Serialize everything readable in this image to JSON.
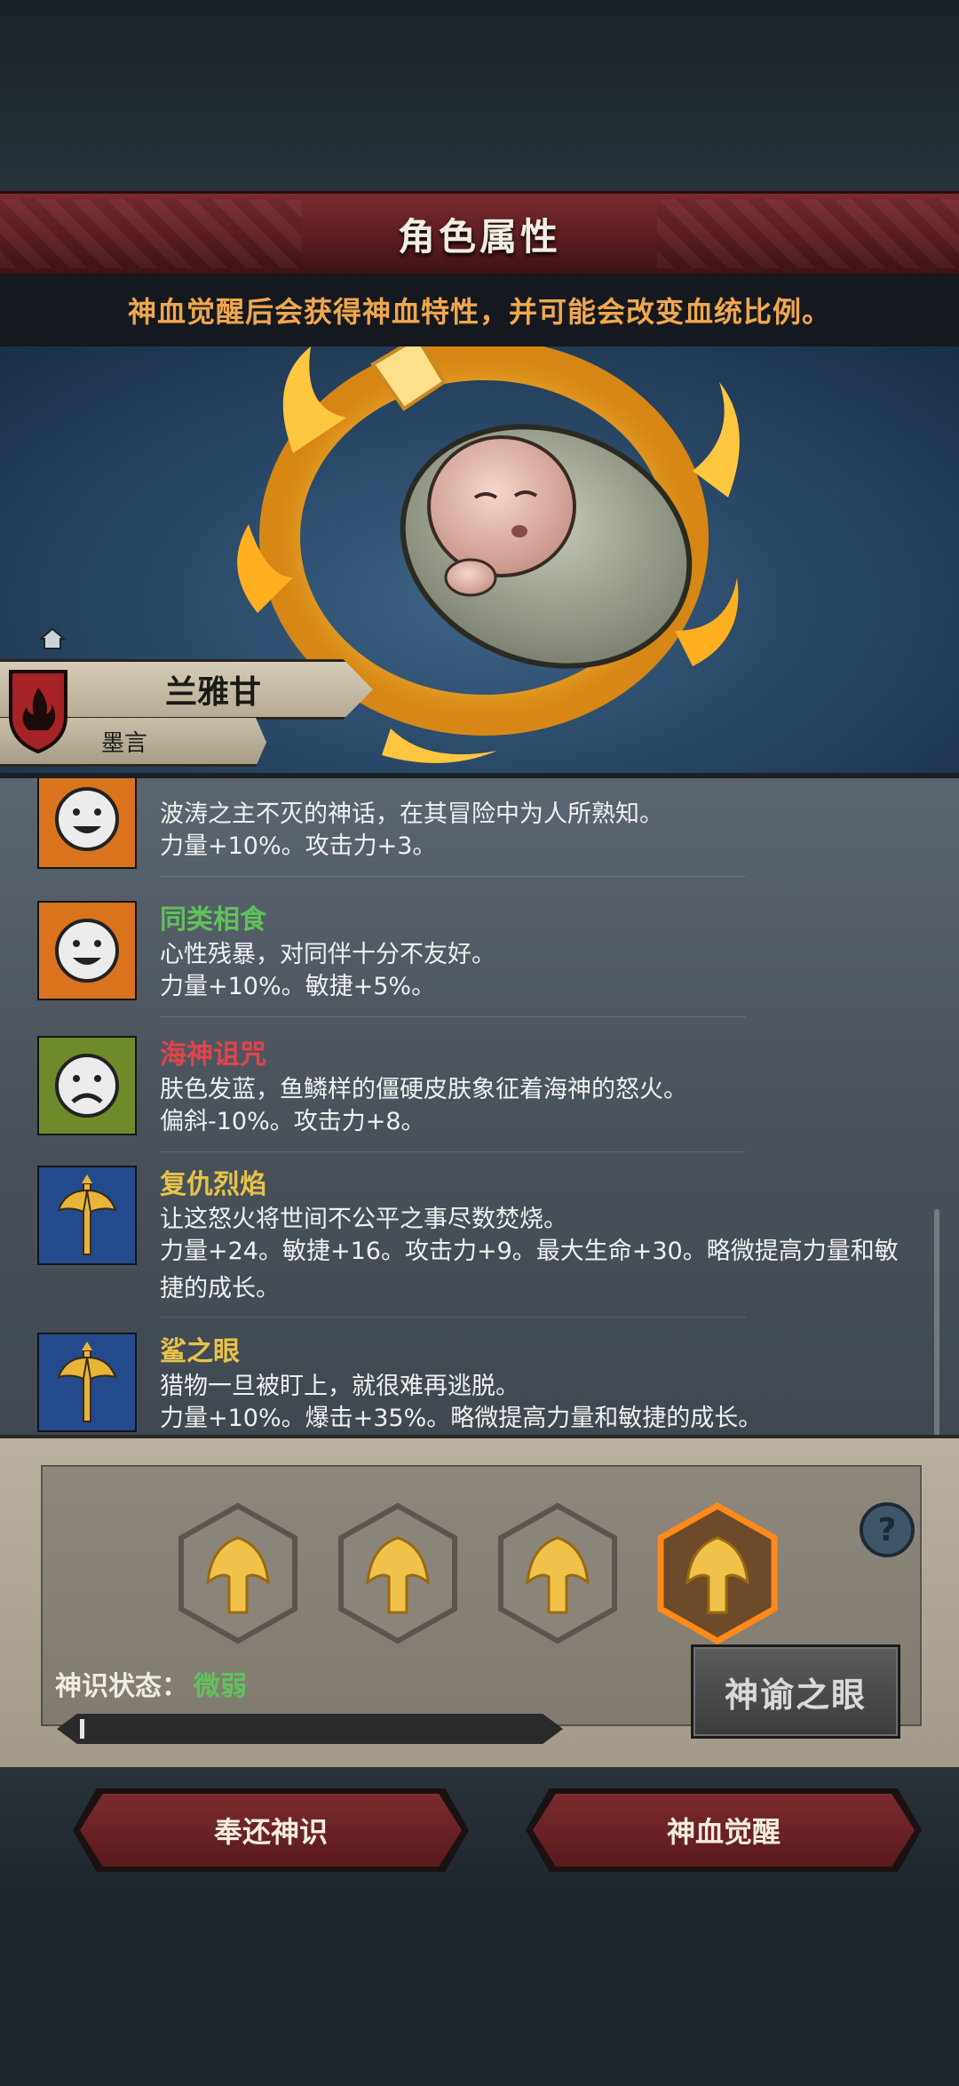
{
  "header": {
    "title": "角色属性",
    "subtitle": "神血觉醒后会获得神血特性，并可能会改变血统比例。"
  },
  "character": {
    "name": "兰雅甘",
    "subname": "墨言",
    "emblem_icon": "fire-shield-icon"
  },
  "traits": [
    {
      "icon": "smile-face-icon",
      "name": "",
      "name_color": "#5fc25a",
      "desc": "波涛之主不灭的神话，在其冒险中为人所熟知。",
      "effect": "力量+10%。攻击力+3。"
    },
    {
      "icon": "smile-face-icon",
      "name": "同类相食",
      "name_color": "#5fc25a",
      "desc": "心性残暴，对同伴十分不友好。",
      "effect": "力量+10%。敏捷+5%。"
    },
    {
      "icon": "sad-face-icon",
      "name": "海神诅咒",
      "name_color": "#e0444a",
      "desc": "肤色发蓝，鱼鳞样的僵硬皮肤象征着海神的怒火。",
      "effect": "偏斜-10%。攻击力+8。"
    },
    {
      "icon": "axe-icon",
      "name": "复仇烈焰",
      "name_color": "#e6c34a",
      "desc": "让这怒火将世间不公平之事尽数焚烧。",
      "effect": "力量+24。敏捷+16。攻击力+9。最大生命+30。略微提高力量和敏捷的成长。"
    },
    {
      "icon": "axe-icon",
      "name": "鲨之眼",
      "name_color": "#e6c34a",
      "desc": "猎物一旦被盯上，就很难再逃脱。",
      "effect": "力量+10%。爆击+35%。略微提高力量和敏捷的成长。"
    }
  ],
  "divine": {
    "slots": [
      "trident-flame-icon",
      "trident-flame-icon",
      "trident-flame-icon",
      "trident-flame-icon"
    ],
    "selected_slot": 4,
    "sense_label": "神识状态：",
    "sense_value": "微弱",
    "sense_progress": 0.01,
    "oracle_button": "神谕之眼"
  },
  "actions": {
    "return_label": "奉还神识",
    "awaken_label": "神血觉醒"
  }
}
